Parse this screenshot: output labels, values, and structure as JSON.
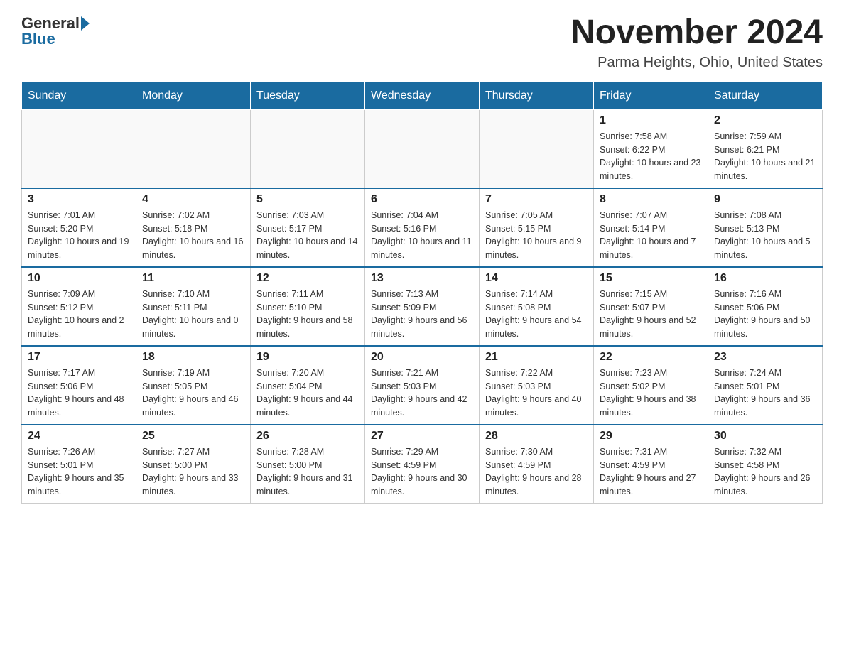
{
  "logo": {
    "general": "General",
    "blue": "Blue"
  },
  "title": "November 2024",
  "subtitle": "Parma Heights, Ohio, United States",
  "days_of_week": [
    "Sunday",
    "Monday",
    "Tuesday",
    "Wednesday",
    "Thursday",
    "Friday",
    "Saturday"
  ],
  "weeks": [
    [
      {
        "day": "",
        "info": ""
      },
      {
        "day": "",
        "info": ""
      },
      {
        "day": "",
        "info": ""
      },
      {
        "day": "",
        "info": ""
      },
      {
        "day": "",
        "info": ""
      },
      {
        "day": "1",
        "info": "Sunrise: 7:58 AM\nSunset: 6:22 PM\nDaylight: 10 hours and 23 minutes."
      },
      {
        "day": "2",
        "info": "Sunrise: 7:59 AM\nSunset: 6:21 PM\nDaylight: 10 hours and 21 minutes."
      }
    ],
    [
      {
        "day": "3",
        "info": "Sunrise: 7:01 AM\nSunset: 5:20 PM\nDaylight: 10 hours and 19 minutes."
      },
      {
        "day": "4",
        "info": "Sunrise: 7:02 AM\nSunset: 5:18 PM\nDaylight: 10 hours and 16 minutes."
      },
      {
        "day": "5",
        "info": "Sunrise: 7:03 AM\nSunset: 5:17 PM\nDaylight: 10 hours and 14 minutes."
      },
      {
        "day": "6",
        "info": "Sunrise: 7:04 AM\nSunset: 5:16 PM\nDaylight: 10 hours and 11 minutes."
      },
      {
        "day": "7",
        "info": "Sunrise: 7:05 AM\nSunset: 5:15 PM\nDaylight: 10 hours and 9 minutes."
      },
      {
        "day": "8",
        "info": "Sunrise: 7:07 AM\nSunset: 5:14 PM\nDaylight: 10 hours and 7 minutes."
      },
      {
        "day": "9",
        "info": "Sunrise: 7:08 AM\nSunset: 5:13 PM\nDaylight: 10 hours and 5 minutes."
      }
    ],
    [
      {
        "day": "10",
        "info": "Sunrise: 7:09 AM\nSunset: 5:12 PM\nDaylight: 10 hours and 2 minutes."
      },
      {
        "day": "11",
        "info": "Sunrise: 7:10 AM\nSunset: 5:11 PM\nDaylight: 10 hours and 0 minutes."
      },
      {
        "day": "12",
        "info": "Sunrise: 7:11 AM\nSunset: 5:10 PM\nDaylight: 9 hours and 58 minutes."
      },
      {
        "day": "13",
        "info": "Sunrise: 7:13 AM\nSunset: 5:09 PM\nDaylight: 9 hours and 56 minutes."
      },
      {
        "day": "14",
        "info": "Sunrise: 7:14 AM\nSunset: 5:08 PM\nDaylight: 9 hours and 54 minutes."
      },
      {
        "day": "15",
        "info": "Sunrise: 7:15 AM\nSunset: 5:07 PM\nDaylight: 9 hours and 52 minutes."
      },
      {
        "day": "16",
        "info": "Sunrise: 7:16 AM\nSunset: 5:06 PM\nDaylight: 9 hours and 50 minutes."
      }
    ],
    [
      {
        "day": "17",
        "info": "Sunrise: 7:17 AM\nSunset: 5:06 PM\nDaylight: 9 hours and 48 minutes."
      },
      {
        "day": "18",
        "info": "Sunrise: 7:19 AM\nSunset: 5:05 PM\nDaylight: 9 hours and 46 minutes."
      },
      {
        "day": "19",
        "info": "Sunrise: 7:20 AM\nSunset: 5:04 PM\nDaylight: 9 hours and 44 minutes."
      },
      {
        "day": "20",
        "info": "Sunrise: 7:21 AM\nSunset: 5:03 PM\nDaylight: 9 hours and 42 minutes."
      },
      {
        "day": "21",
        "info": "Sunrise: 7:22 AM\nSunset: 5:03 PM\nDaylight: 9 hours and 40 minutes."
      },
      {
        "day": "22",
        "info": "Sunrise: 7:23 AM\nSunset: 5:02 PM\nDaylight: 9 hours and 38 minutes."
      },
      {
        "day": "23",
        "info": "Sunrise: 7:24 AM\nSunset: 5:01 PM\nDaylight: 9 hours and 36 minutes."
      }
    ],
    [
      {
        "day": "24",
        "info": "Sunrise: 7:26 AM\nSunset: 5:01 PM\nDaylight: 9 hours and 35 minutes."
      },
      {
        "day": "25",
        "info": "Sunrise: 7:27 AM\nSunset: 5:00 PM\nDaylight: 9 hours and 33 minutes."
      },
      {
        "day": "26",
        "info": "Sunrise: 7:28 AM\nSunset: 5:00 PM\nDaylight: 9 hours and 31 minutes."
      },
      {
        "day": "27",
        "info": "Sunrise: 7:29 AM\nSunset: 4:59 PM\nDaylight: 9 hours and 30 minutes."
      },
      {
        "day": "28",
        "info": "Sunrise: 7:30 AM\nSunset: 4:59 PM\nDaylight: 9 hours and 28 minutes."
      },
      {
        "day": "29",
        "info": "Sunrise: 7:31 AM\nSunset: 4:59 PM\nDaylight: 9 hours and 27 minutes."
      },
      {
        "day": "30",
        "info": "Sunrise: 7:32 AM\nSunset: 4:58 PM\nDaylight: 9 hours and 26 minutes."
      }
    ]
  ]
}
